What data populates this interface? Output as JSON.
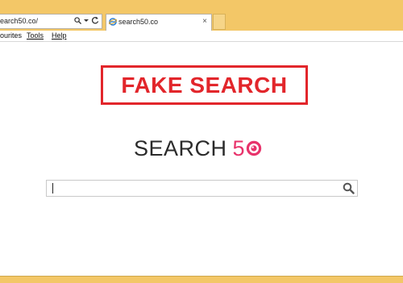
{
  "browser": {
    "address": "earch50.co/",
    "tab_title": "search50.co",
    "tab_close": "×",
    "menu": [
      "ourites",
      "Tools",
      "Help"
    ],
    "icons": [
      "search-icon",
      "dropdown-icon",
      "refresh-icon",
      "ie-favicon",
      "close-icon"
    ]
  },
  "page": {
    "banner_text": "FAKE SEARCH",
    "brand_text": "SEARCH",
    "brand_number": "5",
    "search_value": "",
    "colors": {
      "banner": "#e2262b",
      "brand_accent": "#e8336b",
      "chrome": "#f3c767"
    }
  }
}
